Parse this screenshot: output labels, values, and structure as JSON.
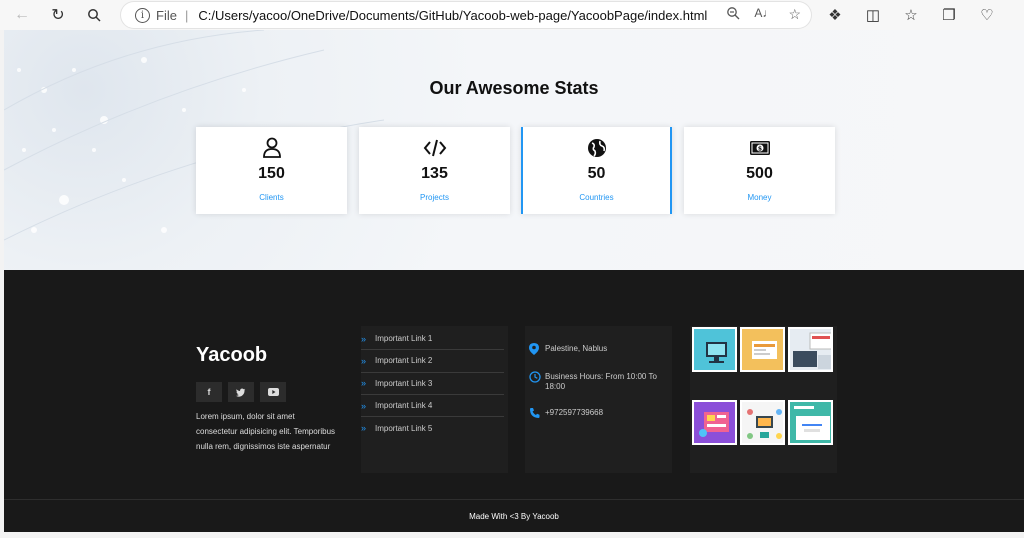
{
  "browser": {
    "file_label": "File",
    "separator": "|",
    "url": "C:/Users/yacoo/OneDrive/Documents/GitHub/Yacoob-web-page/YacoobPage/index.html"
  },
  "stats": {
    "title": "Our Awesome Stats",
    "cards": [
      {
        "icon": "user-icon",
        "value": "150",
        "label": "Clients"
      },
      {
        "icon": "code-icon",
        "value": "135",
        "label": "Projects"
      },
      {
        "icon": "globe-icon",
        "value": "50",
        "label": "Countries"
      },
      {
        "icon": "money-icon",
        "value": "500",
        "label": "Money"
      }
    ]
  },
  "footer": {
    "brand": "Yacoob",
    "socials": [
      {
        "icon": "facebook-icon",
        "glyph": "f"
      },
      {
        "icon": "twitter-icon",
        "glyph": "t"
      },
      {
        "icon": "youtube-icon",
        "glyph": "▶"
      }
    ],
    "about": "Lorem ipsum, dolor sit amet consectetur adipisicing elit. Temporibus nulla rem, dignissimos iste aspernatur",
    "links": [
      "Important Link 1",
      "Important Link 2",
      "Important Link 3",
      "Important Link 4",
      "Important Link 5"
    ],
    "contact": {
      "location": "Palestine, Nablus",
      "hours": "Business Hours: From 10:00 To 18:00",
      "phone": "+972597739668"
    },
    "copyright": "Made With <3 By Yacoob"
  },
  "colors": {
    "accent": "#2196f3",
    "footer_bg": "#191919"
  }
}
